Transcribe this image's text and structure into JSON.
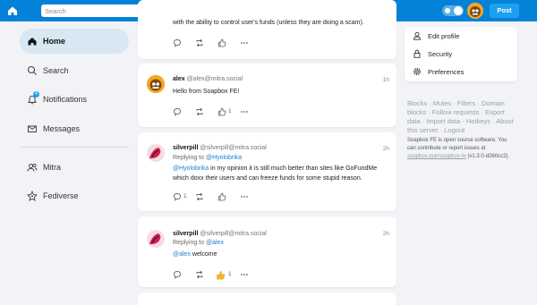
{
  "topbar": {
    "search_placeholder": "Search",
    "post_label": "Post",
    "colors": {
      "bar": "#0482d8",
      "accent": "#1ca1f0"
    }
  },
  "sidebar": {
    "items": [
      {
        "label": "Home",
        "icon": "home-icon",
        "active": true
      },
      {
        "label": "Search",
        "icon": "search-icon"
      },
      {
        "label": "Notifications",
        "icon": "bell-icon",
        "badge": "4"
      },
      {
        "label": "Messages",
        "icon": "envelope-icon"
      },
      {
        "label": "Mitra",
        "icon": "users-icon"
      },
      {
        "label": "Fediverse",
        "icon": "fediverse-icon"
      }
    ]
  },
  "feed": {
    "post0": {
      "text": "with the ability to control user's funds (unless they are doing a scam)."
    },
    "post1": {
      "name": "alex",
      "acct": "@alex@mitra.social",
      "time": "1h",
      "text": "Hello from Soapbox FE!",
      "likes": "1"
    },
    "post2": {
      "name": "silverpill",
      "acct": "@silverpill@mitra.social",
      "time": "2h",
      "replying_prefix": "Replying to ",
      "replying_to": "@Hyolobrika",
      "mention": "@Hyolobrika",
      "text": " in my opinion it is still much better than sites like GoFundMe which doxx their users and can freeze funds for some stupid reason.",
      "replies": "1"
    },
    "post3": {
      "name": "silverpill",
      "acct": "@silverpill@mitra.social",
      "time": "2h",
      "replying_prefix": "Replying to ",
      "replying_to": "@alex",
      "mention": "@alex",
      "text": " welcome",
      "likes": "1"
    }
  },
  "right_menu": {
    "items": [
      {
        "label": "Edit profile",
        "icon": "user-icon"
      },
      {
        "label": "Security",
        "icon": "lock-icon"
      },
      {
        "label": "Preferences",
        "icon": "gear-icon"
      }
    ]
  },
  "footer": {
    "links": "Blocks · Mutes · Filters · Domain blocks · Follow requests · Export data · Import data · Hotkeys · About this server · Logout",
    "note_prefix": "Soapbox FE is open source software. You can contribute or report issues at ",
    "note_link": "soapbox.pub/soapbox-fe",
    "note_suffix": " (v1.3.0-d260cc2)."
  }
}
